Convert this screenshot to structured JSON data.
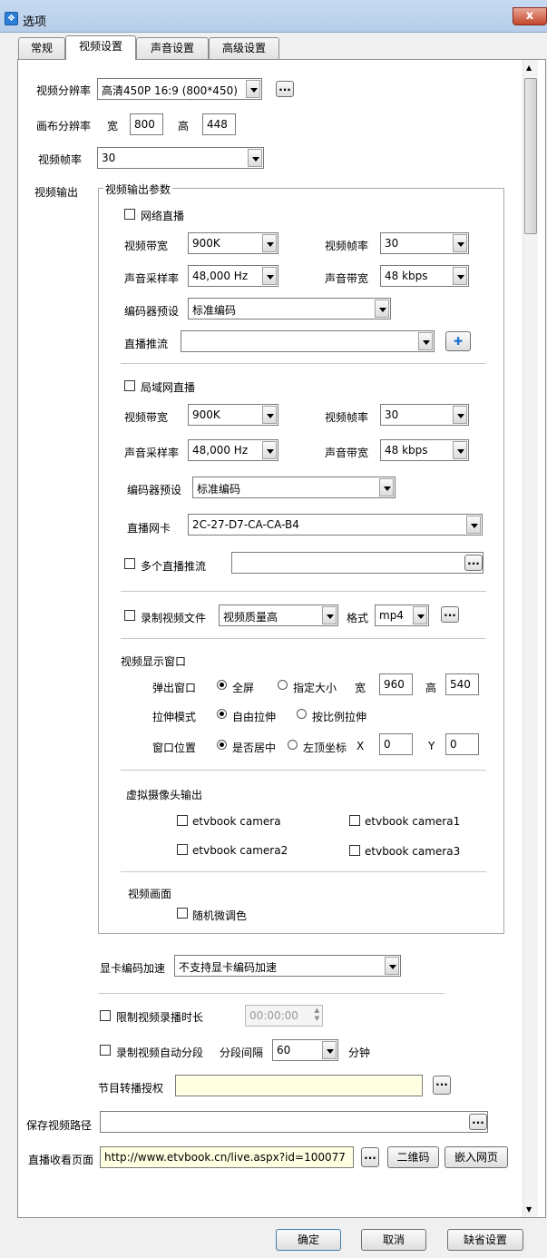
{
  "window": {
    "title": "选项",
    "close": "x"
  },
  "tabs": [
    "常规",
    "视频设置",
    "声音设置",
    "高级设置"
  ],
  "video": {
    "resolution_label": "视频分辨率",
    "resolution_value": "高清450P 16:9 (800*450)",
    "canvas_label": "画布分辨率",
    "canvas_w_label": "宽",
    "canvas_w": "800",
    "canvas_h_label": "高",
    "canvas_h": "448",
    "fps_label": "视频帧率",
    "fps_value": "30",
    "output_label": "视频输出",
    "group_title": "视频输出参数"
  },
  "net_live": {
    "label": "网络直播",
    "vbitrate_label": "视频带宽",
    "vbitrate": "900K",
    "vfps_label": "视频帧率",
    "vfps": "30",
    "samplerate_label": "声音采样率",
    "samplerate": "48,000 Hz",
    "abitrate_label": "声音带宽",
    "abitrate": "48 kbps",
    "preset_label": "编码器预设",
    "preset": "标准编码",
    "push_label": "直播推流",
    "push_value": "",
    "add": "✚"
  },
  "lan_live": {
    "label": "局域网直播",
    "vbitrate_label": "视频带宽",
    "vbitrate": "900K",
    "vfps_label": "视频帧率",
    "vfps": "30",
    "samplerate_label": "声音采样率",
    "samplerate": "48,000 Hz",
    "abitrate_label": "声音带宽",
    "abitrate": "48 kbps",
    "preset_label": "编码器预设",
    "preset": "标准编码",
    "nic_label": "直播网卡",
    "nic": "2C-27-D7-CA-CA-B4",
    "multi_label": "多个直播推流",
    "multi_value": ""
  },
  "record": {
    "label": "录制视频文件",
    "quality": "视频质量高",
    "format_label": "格式",
    "format": "mp4"
  },
  "display": {
    "title": "视频显示窗口",
    "popup_label": "弹出窗口",
    "full": "全屏",
    "custom": "指定大小",
    "w_label": "宽",
    "w": "960",
    "h_label": "高",
    "h": "540",
    "stretch_label": "拉伸模式",
    "free": "自由拉伸",
    "ratio": "按比例拉伸",
    "pos_label": "窗口位置",
    "center": "是否居中",
    "topleft": "左顶坐标",
    "x_label": "X",
    "x": "0",
    "y_label": "Y",
    "y": "0"
  },
  "vcam": {
    "title": "虚拟摄像头输出",
    "cams": [
      "etvbook camera",
      "etvbook camera1",
      "etvbook camera2",
      "etvbook camera3"
    ]
  },
  "picture": {
    "title": "视频画面",
    "random": "随机微调色"
  },
  "gpu": {
    "label": "显卡编码加速",
    "value": "不支持显卡编码加速"
  },
  "limit": {
    "label": "限制视频录播时长",
    "value": "00:00:00"
  },
  "segment": {
    "label": "录制视频自动分段",
    "interval_label": "分段间隔",
    "interval": "60",
    "unit": "分钟"
  },
  "auth": {
    "label": "节目转播授权",
    "value": ""
  },
  "save": {
    "label": "保存视频路径",
    "value": ""
  },
  "watch": {
    "label": "直播收看页面",
    "url": "http://www.etvbook.cn/live.aspx?id=100077",
    "qr": "二维码",
    "embed": "嵌入网页"
  },
  "footer": {
    "ok": "确定",
    "cancel": "取消",
    "default": "缺省设置"
  },
  "dots": "..."
}
